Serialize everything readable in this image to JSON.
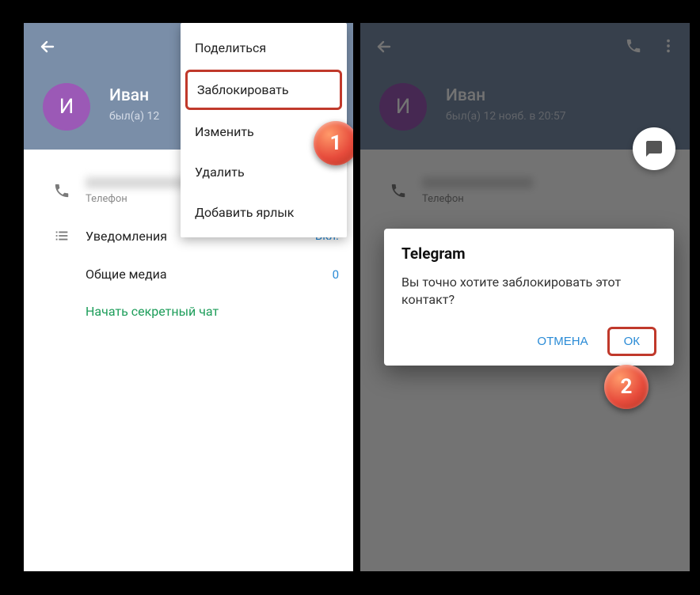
{
  "left": {
    "contact_name": "Иван",
    "contact_initial": "И",
    "status": "был(а) 12",
    "menu": {
      "share": "Поделиться",
      "block": "Заблокировать",
      "edit": "Изменить",
      "delete": "Удалить",
      "add_shortcut": "Добавить ярлык"
    },
    "phone_label": "Телефон",
    "notifications": {
      "label": "Уведомления",
      "value": "Вкл."
    },
    "shared_media": {
      "label": "Общие медиа",
      "value": "0"
    },
    "secret_chat": "Начать секретный чат",
    "badge": "1"
  },
  "right": {
    "contact_name": "Иван",
    "contact_initial": "И",
    "status": "был(а) 12 нояб. в 20:57",
    "phone_label": "Телефон",
    "dialog": {
      "title": "Telegram",
      "message": "Вы точно хотите заблокировать этот контакт?",
      "cancel": "ОТМЕНА",
      "ok": "ОК"
    },
    "badge": "2"
  }
}
